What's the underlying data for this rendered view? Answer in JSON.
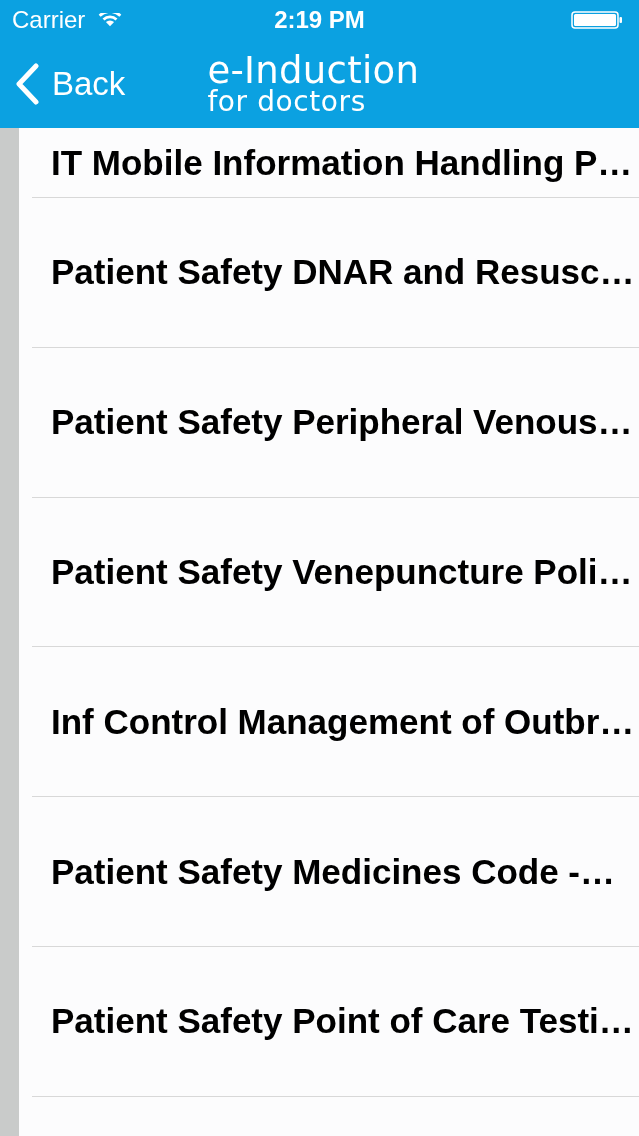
{
  "status_bar": {
    "carrier": "Carrier",
    "time": "2:19 PM"
  },
  "nav_bar": {
    "back": "Back",
    "title": "e-Induction",
    "subtitle": "for doctors"
  },
  "list": {
    "items": [
      {
        "title": "IT Mobile Information Handling P…"
      },
      {
        "title": "Patient Safety DNAR and Resusc…"
      },
      {
        "title": "Patient Safety Peripheral Venous…"
      },
      {
        "title": "Patient Safety Venepuncture Poli…"
      },
      {
        "title": "Inf Control Management of Outbr…"
      },
      {
        "title": "Patient Safety Medicines Code -…"
      },
      {
        "title": "Patient Safety Point of Care Testi…"
      }
    ]
  }
}
